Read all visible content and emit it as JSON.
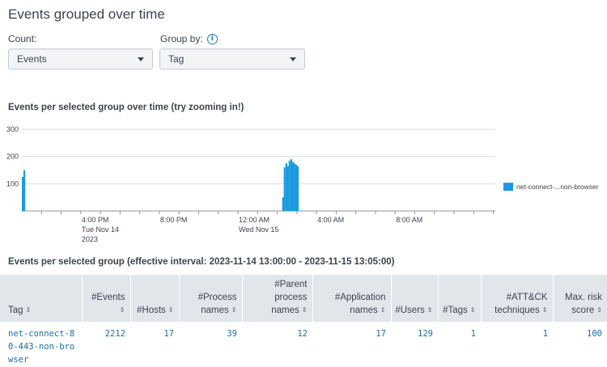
{
  "page": {
    "title": "Events grouped over time"
  },
  "controls": {
    "count_label": "Count:",
    "count_value": "Events",
    "group_label": "Group by:",
    "group_value": "Tag",
    "info_glyph": "i"
  },
  "chart_section_title": "Events per selected group over time (try zooming in!)",
  "table_section_title": "Events per selected group (effective interval: 2023-11-14 13:00:00 - 2023-11-15 13:05:00)",
  "chart_data": {
    "type": "bar",
    "title": "Events per selected group over time (try zooming in!)",
    "xlabel": "",
    "ylabel": "",
    "ylim": [
      0,
      300
    ],
    "y_ticks": [
      "100",
      "200",
      "300"
    ],
    "x_ticks": [
      {
        "hour": 16,
        "label": "4:00 PM",
        "sub": [
          "Tue Nov 14",
          "2023"
        ]
      },
      {
        "hour": 20,
        "label": "8:00 PM",
        "sub": []
      },
      {
        "hour": 24,
        "label": "12:00 AM",
        "sub": [
          "Wed Nov 15"
        ]
      },
      {
        "hour": 28,
        "label": "4:00 AM",
        "sub": []
      },
      {
        "hour": 32,
        "label": "8:00 AM",
        "sub": []
      }
    ],
    "x_range_hours": [
      13,
      37.1
    ],
    "legend_position": "right",
    "series": [
      {
        "name": "net-connect-...non-browser",
        "color": "#1a9be0",
        "points": [
          {
            "h": 13.0,
            "v": 125
          },
          {
            "h": 13.08,
            "v": 150
          },
          {
            "h": 26.25,
            "v": 50
          },
          {
            "h": 26.33,
            "v": 160
          },
          {
            "h": 26.42,
            "v": 175
          },
          {
            "h": 26.5,
            "v": 165
          },
          {
            "h": 26.58,
            "v": 185
          },
          {
            "h": 26.67,
            "v": 190
          },
          {
            "h": 26.75,
            "v": 180
          },
          {
            "h": 26.83,
            "v": 175
          },
          {
            "h": 26.92,
            "v": 170
          },
          {
            "h": 27.0,
            "v": 165
          }
        ]
      }
    ]
  },
  "legend": {
    "label": "net-connect-...non-browser"
  },
  "table": {
    "columns": [
      {
        "label": "Tag",
        "align": "left"
      },
      {
        "label": "#Events"
      },
      {
        "label": "#Hosts"
      },
      {
        "label": "#Process names"
      },
      {
        "label": "#Parent process names"
      },
      {
        "label": "#Application names"
      },
      {
        "label": "#Users"
      },
      {
        "label": "#Tags"
      },
      {
        "label": "#ATT&CK techniques"
      },
      {
        "label": "Max. risk score"
      }
    ],
    "sort_glyph": "⇕",
    "rows": [
      [
        "net-connect-80-443-non-browser",
        "2212",
        "17",
        "39",
        "12",
        "17",
        "129",
        "1",
        "1",
        "100"
      ]
    ]
  }
}
